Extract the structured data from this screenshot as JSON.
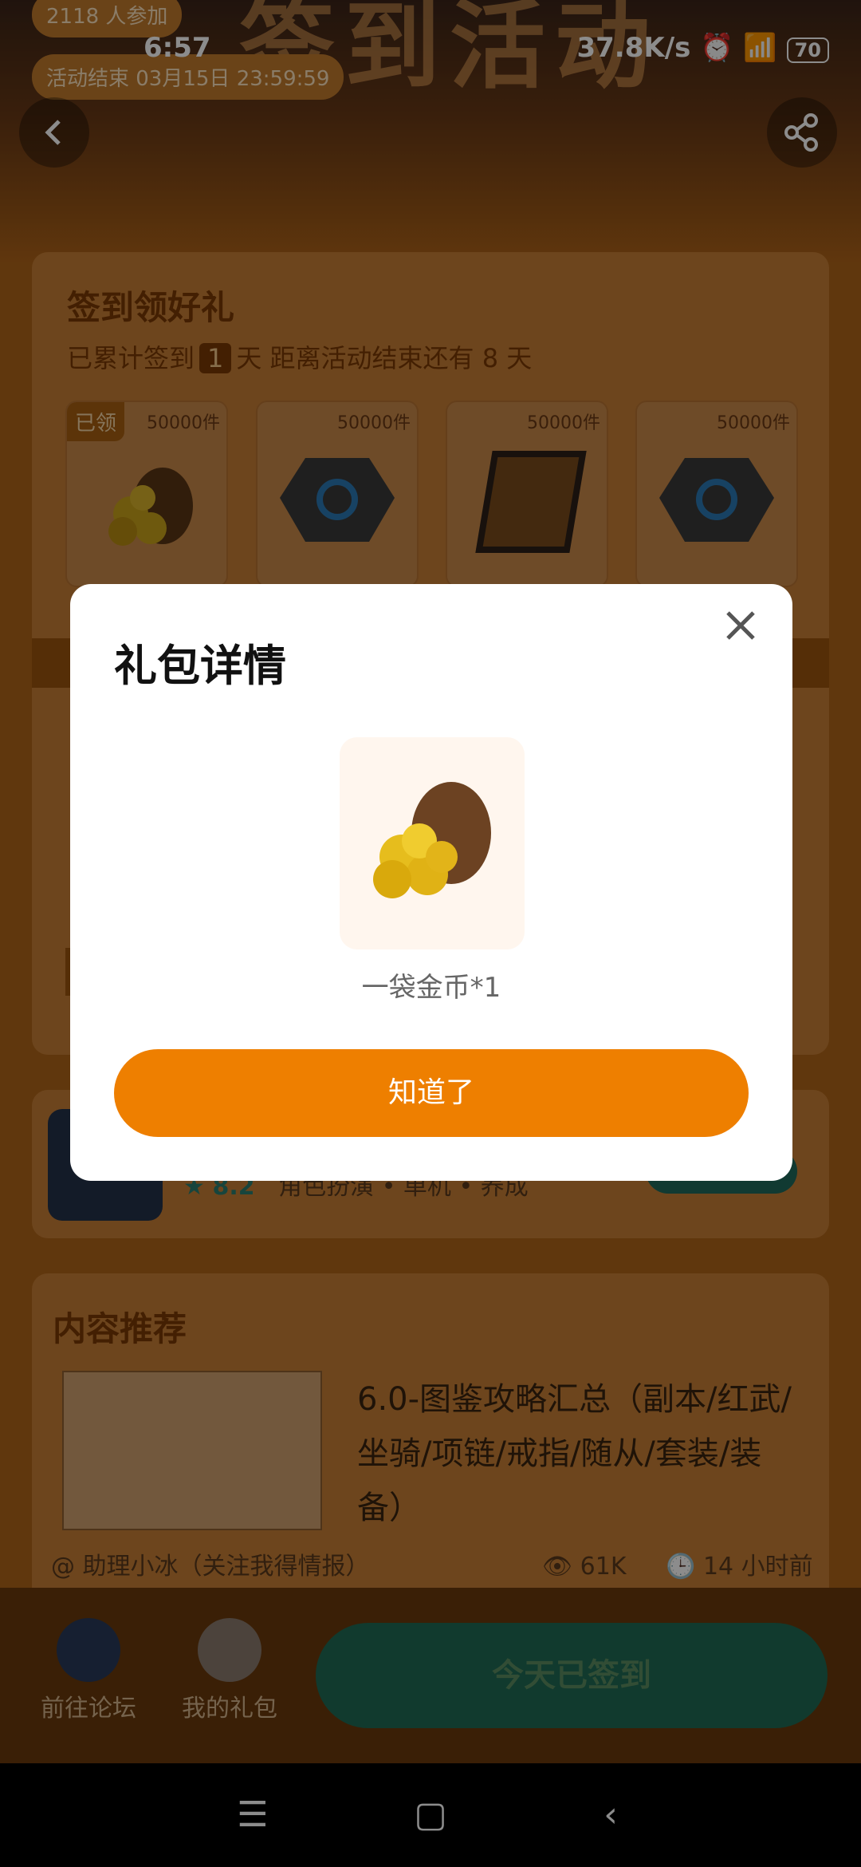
{
  "status_bar": {
    "time": "6:57",
    "network_speed": "37.8K/s",
    "battery": "70"
  },
  "banner": {
    "title": "签到活动",
    "participants": "2118 人参加",
    "end_time": "活动结束 03月15日 23:59:59"
  },
  "checkin": {
    "title": "签到领好礼",
    "prefix": "已累计签到",
    "days": "1",
    "mid": "天  距离活动结束还有 8 天",
    "gifts": [
      {
        "count": "50000件",
        "tag": "已领",
        "icon": "gold-bag-icon"
      },
      {
        "count": "50000件",
        "tag": "",
        "icon": "rune-stone-icon"
      },
      {
        "count": "50000件",
        "tag": "",
        "icon": "scroll-icon"
      },
      {
        "count": "50000件",
        "tag": "",
        "icon": "rune-stone-icon"
      }
    ]
  },
  "game": {
    "rating": "8.2",
    "tags": "角色扮演 • 单机 • 养成"
  },
  "recommend": {
    "title": "内容推荐",
    "article_title": "6.0-图鉴攻略汇总（副本/红武/坐骑/项链/戒指/随从/套装/装备）",
    "author": "@ 助理小冰（关注我得情报）",
    "views": "61K",
    "time": "14 小时前"
  },
  "bottom": {
    "forum": "前往论坛",
    "my_gifts": "我的礼包",
    "checkin_btn": "今天已签到"
  },
  "modal": {
    "title": "礼包详情",
    "gift_name": "一袋金币*1",
    "ok": "知道了",
    "close_icon": "close-icon"
  },
  "colors": {
    "accent": "#ee7f00",
    "modal_bg": "#ffffff"
  }
}
